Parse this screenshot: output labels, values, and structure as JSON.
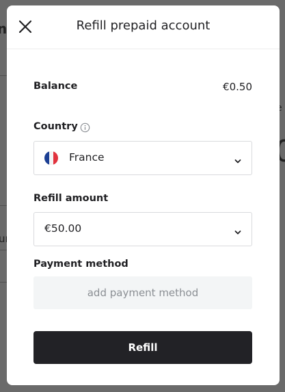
{
  "background": {
    "left_fragment_1": "n",
    "left_fragment_2": "ur",
    "right_fragment_1": "e",
    "right_fragment_2": "0"
  },
  "modal": {
    "title": "Refill prepaid account",
    "close_icon": "close-icon",
    "balance": {
      "label": "Balance",
      "value": "€0.50"
    },
    "country": {
      "label": "Country",
      "info_icon": "info-icon",
      "selected": "France",
      "flag_icon": "france-flag-icon"
    },
    "refill_amount": {
      "label": "Refill amount",
      "selected": "€50.00"
    },
    "payment_method": {
      "label": "Payment method",
      "add_label": "add payment method"
    },
    "refill_button": "Refill"
  },
  "colors": {
    "primary_button": "#222226",
    "muted_text": "#8b8f94",
    "payment_bg": "#f3f5f6",
    "flag_blue": "#1c3f94",
    "flag_red": "#e1323d"
  }
}
